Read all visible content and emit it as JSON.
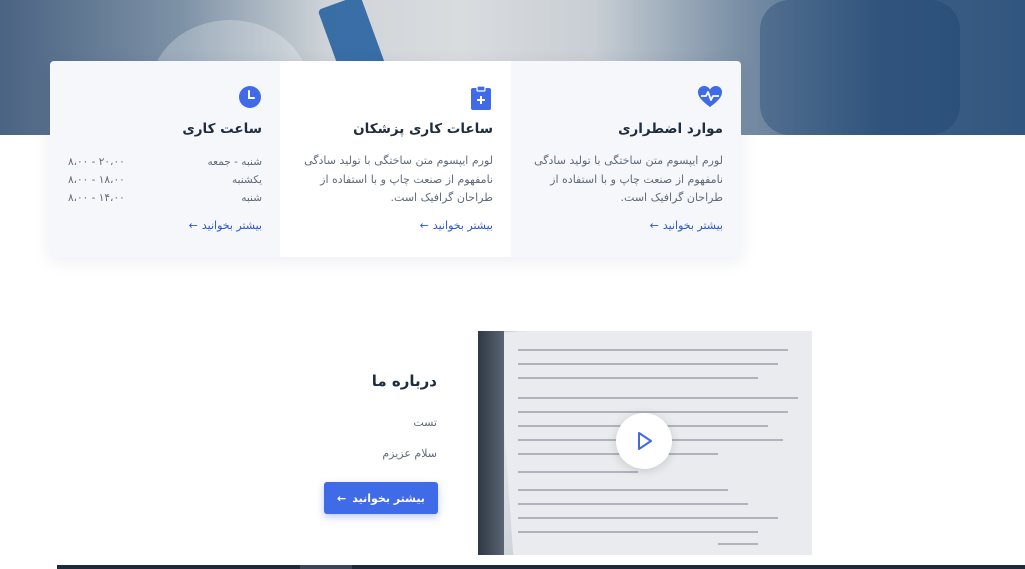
{
  "cards": [
    {
      "icon": "clock-icon",
      "title": "ساعت کاری",
      "hours": [
        {
          "day": "شنبه - جمعه",
          "time": "۸،۰۰ - ۲۰،۰۰"
        },
        {
          "day": "یکشنبه",
          "time": "۸،۰۰ - ۱۸،۰۰"
        },
        {
          "day": "شنبه",
          "time": "۸،۰۰ - ۱۴،۰۰"
        }
      ],
      "more": "بیشتر بخوانید"
    },
    {
      "icon": "clipboard-plus-icon",
      "title": "ساعات کاری پزشکان",
      "desc": "لورم ایپسوم متن ساختگی با تولید سادگی نامفهوم از صنعت چاپ و با استفاده از طراحان گرافیک است.",
      "more": "بیشتر بخوانید"
    },
    {
      "icon": "heart-pulse-icon",
      "title": "موارد اضطراری",
      "desc": "لورم ایپسوم متن ساختگی با تولید سادگی نامفهوم از صنعت چاپ و با استفاده از طراحان گرافیک است.",
      "more": "بیشتر بخوانید"
    }
  ],
  "about": {
    "title": "درباره ما",
    "line1": "تست",
    "line2": "سلام عزیزم",
    "button": "بیشتر بخوانید"
  },
  "colors": {
    "accent": "#3f6ae8",
    "link": "#2b56d6",
    "card_bg": "#f5f7fb"
  }
}
